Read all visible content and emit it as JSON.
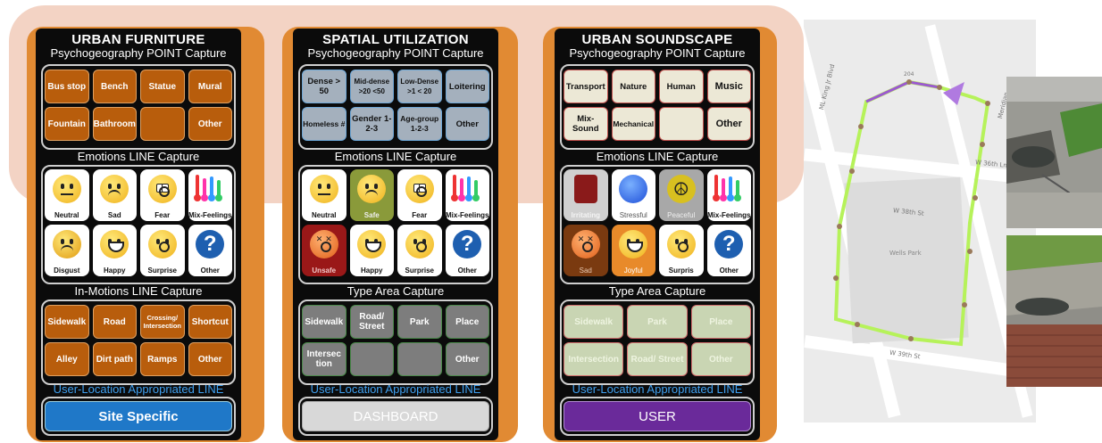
{
  "furniture": {
    "title": "URBAN FURNITURE",
    "subtitle": "Psychogeography POINT Capture",
    "buttons": [
      "Bus stop",
      "Bench",
      "Statue",
      "Mural",
      "Fountain",
      "Bathroom",
      "",
      "Other"
    ],
    "emotions_title": "Emotions LINE Capture",
    "emotions": [
      "Neutral",
      "Sad",
      "Fear",
      "Mix-Feelings",
      "Disgust",
      "Happy",
      "Surprise",
      "Other"
    ],
    "inmotion_title": "In-Motions LINE Capture",
    "inmotions": [
      "Sidewalk",
      "Road",
      "Crossing/ Intersection",
      "Shortcut",
      "Alley",
      "Dirt path",
      "Ramps",
      "Other"
    ],
    "user_title": "User-Location Appropriated LINE",
    "bottom_button": "Site Specific"
  },
  "spatial": {
    "title": "SPATIAL UTILIZATION",
    "subtitle": "Psychogeography POINT Capture",
    "buttons": [
      "Dense > 50",
      "Mid-dense >20 <50",
      "Low-Dense >1 < 20",
      "Loitering",
      "Homeless #",
      "Gender 1-2-3",
      "Age-group 1-2-3",
      "Other"
    ],
    "emotions_title": "Emotions LINE Capture",
    "emotions": [
      "Neutral",
      "Safe",
      "Fear",
      "Mix-Feelings",
      "Unsafe",
      "Happy",
      "Surprise",
      "Other"
    ],
    "area_title": "Type Area Capture",
    "areas": [
      "Sidewalk",
      "Road/ Street",
      "Park",
      "Place",
      "Intersec tion",
      "",
      "",
      "Other"
    ],
    "user_title": "User-Location Appropriated LINE",
    "bottom_button": "DASHBOARD"
  },
  "soundscape": {
    "title": "URBAN SOUNDSCAPE",
    "subtitle": "Psychogeography POINT Capture",
    "buttons": [
      "Transport",
      "Nature",
      "Human",
      "Music",
      "Mix-Sound",
      "Mechanical",
      "",
      "Other"
    ],
    "emotions_title": "Emotions LINE Capture",
    "emotions": [
      "Irritating",
      "Stressful",
      "Peaceful",
      "Mix-Feelings",
      "Sad",
      "Joyful",
      "Surpris",
      "Other"
    ],
    "area_title": "Type Area Capture",
    "areas": [
      "Sidewalk",
      "Park",
      "Place",
      "Intersection",
      "Road/ Street",
      "Other"
    ],
    "user_title": "User-Location Appropriated LINE",
    "bottom_button": "USER"
  },
  "map": {
    "labels": [
      "ML King Jr Blvd",
      "W 38th St",
      "W 39th St",
      "Wells Park",
      "W 36th Ln",
      "Meridian",
      "204"
    ]
  },
  "colors": {
    "orange_button": "#b85d0c",
    "site_specific": "#1f78c8",
    "dashboard": "#d8d8d8",
    "user": "#6a2a9a",
    "route": "#b6f25a",
    "route_purple": "#9b59d0"
  }
}
